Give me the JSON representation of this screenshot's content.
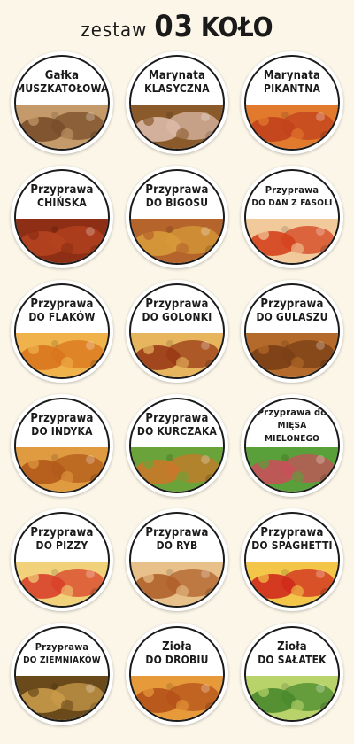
{
  "header": {
    "prefix": "zestaw",
    "number": "03",
    "suffix": "KOŁO"
  },
  "stickers": [
    {
      "line1": "Gałka",
      "line2": "muszkatołowa",
      "food": "nutmeg-icon",
      "c1": "#7a4e2a",
      "c2": "#c49a6a"
    },
    {
      "line1": "Marynata",
      "line2": "Klasyczna",
      "food": "roast-meat-icon",
      "c1": "#d9b9a7",
      "c2": "#8b5a2b"
    },
    {
      "line1": "Marynata",
      "line2": "pikantna",
      "food": "spicy-meat-icon",
      "c1": "#c2411c",
      "c2": "#e27a2e"
    },
    {
      "line1": "Przyprawa",
      "line2": "chińska",
      "food": "spice-powder-icon",
      "c1": "#b4431f",
      "c2": "#8e2e14"
    },
    {
      "line1": "Przyprawa",
      "line2": "do bigosu",
      "food": "sauerkraut-icon",
      "c1": "#d79a3a",
      "c2": "#b5642b"
    },
    {
      "line1": "Przyprawa",
      "line2": "do dań z fasoli",
      "food": "beans-icon",
      "c1": "#d4421d",
      "c2": "#f1c99a"
    },
    {
      "line1": "Przyprawa",
      "line2": "do flaków",
      "food": "tripe-soup-icon",
      "c1": "#d9751e",
      "c2": "#f0b24a"
    },
    {
      "line1": "Przyprawa",
      "line2": "do golonki",
      "food": "pork-knuckle-icon",
      "c1": "#9a3a16",
      "c2": "#e7b55e"
    },
    {
      "line1": "Przyprawa",
      "line2": "do gulaszu",
      "food": "goulash-icon",
      "c1": "#7a3f16",
      "c2": "#b46a2a"
    },
    {
      "line1": "Przyprawa",
      "line2": "do indyka",
      "food": "turkey-icon",
      "c1": "#b25a1a",
      "c2": "#e09a40"
    },
    {
      "line1": "Przyprawa",
      "line2": "do kurczaka",
      "food": "chicken-icon",
      "c1": "#c9782a",
      "c2": "#6aa33a"
    },
    {
      "line1": "Przyprawa do",
      "line2": "mięsa mielonego",
      "food": "minced-meat-icon",
      "c1": "#c7505a",
      "c2": "#5aa03a"
    },
    {
      "line1": "Przyprawa",
      "line2": "do pizzy",
      "food": "pizza-icon",
      "c1": "#d8402a",
      "c2": "#f1d27a"
    },
    {
      "line1": "Przyprawa",
      "line2": "do ryb",
      "food": "fish-icon",
      "c1": "#b0602a",
      "c2": "#e8c08a"
    },
    {
      "line1": "Przyprawa",
      "line2": "do spaghetti",
      "food": "spaghetti-icon",
      "c1": "#d02a1c",
      "c2": "#f3c64a"
    },
    {
      "line1": "Przyprawa",
      "line2": "do ziemniaków",
      "food": "potatoes-icon",
      "c1": "#c89a4a",
      "c2": "#6a4a1a"
    },
    {
      "line1": "Zioła",
      "line2": "do drobiu",
      "food": "roast-chicken-icon",
      "c1": "#b5521a",
      "c2": "#e79a3a"
    },
    {
      "line1": "Zioła",
      "line2": "do sałatek",
      "food": "salad-icon",
      "c1": "#4a8a2e",
      "c2": "#b8d36a"
    }
  ]
}
